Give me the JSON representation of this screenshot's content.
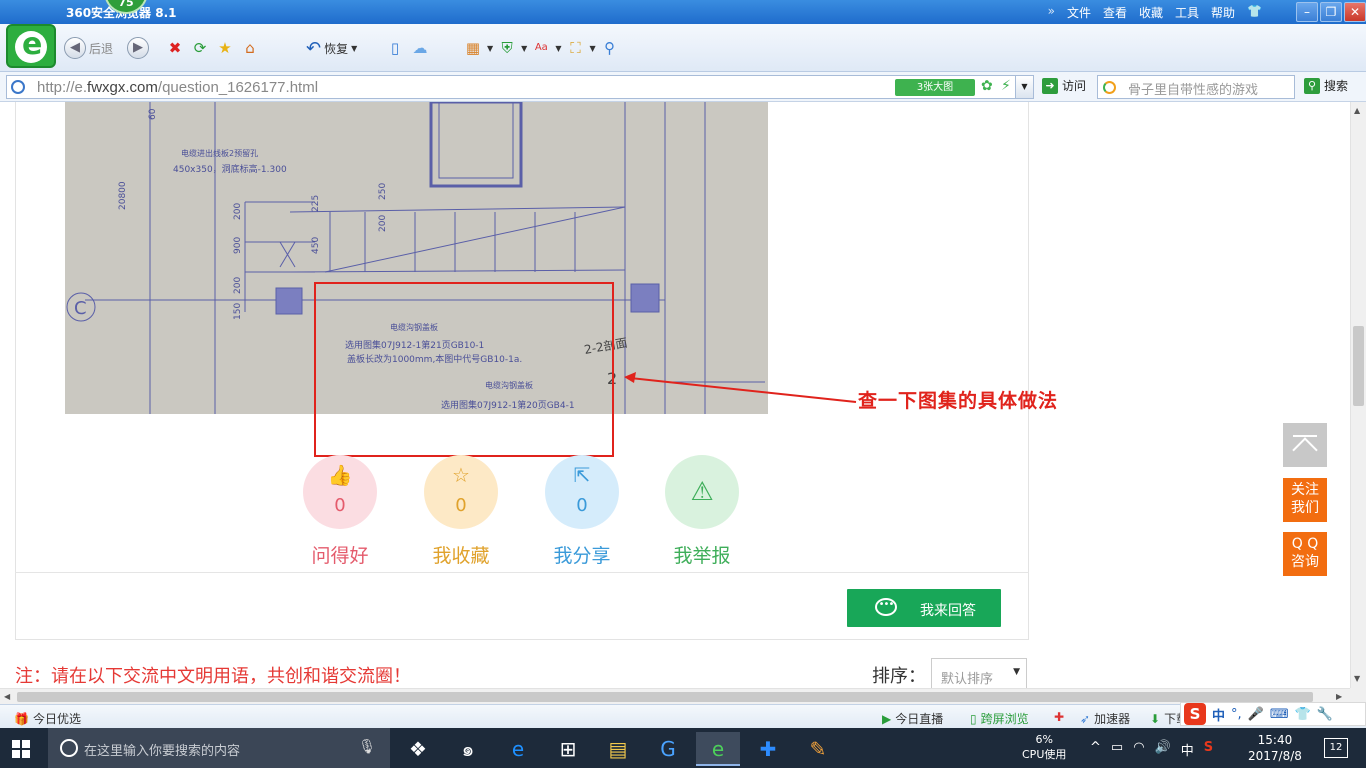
{
  "browser": {
    "title": "360安全浏览器 8.1",
    "badge": "75",
    "menu": [
      "文件",
      "查看",
      "收藏",
      "工具",
      "帮助"
    ],
    "back_label": "后退",
    "restore_label": "恢复",
    "url_host": "http://e.",
    "url_domain": "fwxgx.com",
    "url_path": "/question_1626177.html",
    "big_image_label": "3张大图",
    "visit_label": "访问",
    "search_placeholder": "骨子里自带性感的游戏",
    "search_label": "搜索"
  },
  "blueprint": {
    "dim_labels": [
      "20800",
      "200",
      "900",
      "200",
      "150",
      "450",
      "250",
      "200",
      "225",
      "60"
    ],
    "axis_label": "C",
    "cable_hole_line1": "电缆进出线板2预留孔",
    "cable_hole_line2": "450x350，洞底标高-1.300",
    "cover_title": "电缆沟钢盖板",
    "cover_line1": "选用图集07J912-1第21页GB10-1",
    "cover_line2": "盖板长改为1000mm,本图中代号GB10-1a.",
    "cover2_title": "电缆沟钢盖板",
    "cover2_line1": "选用图集07J912-1第20页GB4-1",
    "handwritten": "2-2剖面",
    "section_mark": "2"
  },
  "annotation": {
    "note": "查一下图集的具体做法"
  },
  "actions": [
    {
      "label": "问得好",
      "count": "0",
      "color": "#e45b6c",
      "bg": "#fbdde2",
      "icon": "thumbs-up-icon"
    },
    {
      "label": "我收藏",
      "count": "0",
      "color": "#e0a22c",
      "bg": "#fde9c6",
      "icon": "star-icon"
    },
    {
      "label": "我分享",
      "count": "0",
      "color": "#3a9ad9",
      "bg": "#d5ecfb",
      "icon": "share-icon"
    },
    {
      "label": "我举报",
      "count": "",
      "color": "#3fae5a",
      "bg": "#d9f2de",
      "icon": "warning-icon"
    }
  ],
  "answer_button": {
    "label": "我来回答",
    "color": "#18a758"
  },
  "notice": "注：请在以下交流中文明用语，共创和谐交流圈！",
  "sort": {
    "label": "排序：",
    "selected": "默认排序"
  },
  "side": {
    "follow_line1": "关注",
    "follow_line2": "我们",
    "qq_line1": "Q Q",
    "qq_line2": "咨询",
    "accent": "#f26d10"
  },
  "statusbar": {
    "today_pick": "今日优选",
    "today_live": "今日直播",
    "cross_screen": "跨屏浏览",
    "accelerator": "加速器",
    "download": "下载"
  },
  "ime": {
    "lang": "中"
  },
  "taskbar": {
    "search_placeholder": "在这里输入你要搜索的内容",
    "cpu_percent": "6%",
    "cpu_label": "CPU使用",
    "input_lang": "中",
    "time": "15:40",
    "date": "2017/8/8",
    "notifications": "12"
  }
}
